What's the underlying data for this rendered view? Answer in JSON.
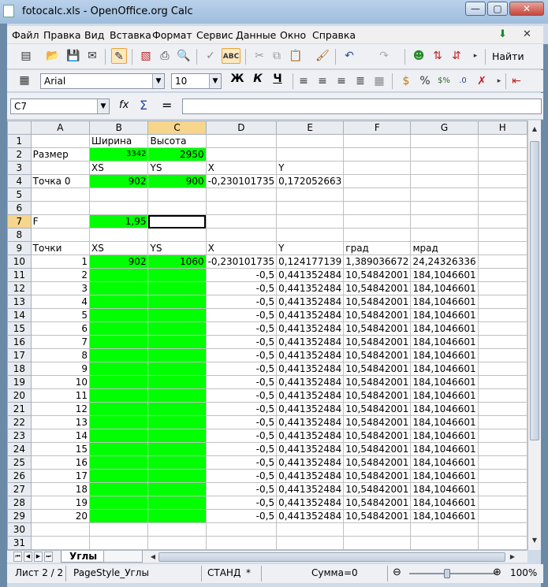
{
  "window": {
    "title": "fotocalc.xls - OpenOffice.org Calc",
    "minimize": "—",
    "maximize": "▢",
    "close": "✕"
  },
  "menu": [
    {
      "label": "Файл"
    },
    {
      "label": "Правка"
    },
    {
      "label": "Вид"
    },
    {
      "label": "Вставка"
    },
    {
      "label": "Формат"
    },
    {
      "label": "Сервис"
    },
    {
      "label": "Данные"
    },
    {
      "label": "Окно"
    },
    {
      "label": "Справка"
    }
  ],
  "toolbar": {
    "find_label": "Найти"
  },
  "format": {
    "font_name": "Arial",
    "font_size": "10",
    "bold": "Ж",
    "italic": "К",
    "underline": "Ч"
  },
  "formula": {
    "cell_ref": "C7",
    "fx": "fx",
    "sum": "Σ",
    "eq": "=",
    "value": ""
  },
  "columns": [
    "A",
    "B",
    "C",
    "D",
    "E",
    "F",
    "G",
    "H"
  ],
  "rows": [
    {
      "n": "1",
      "cells": [
        "",
        "Ширина",
        "Высота",
        "",
        "",
        "",
        "",
        ""
      ]
    },
    {
      "n": "2",
      "cells": [
        "Размер",
        "3342",
        "2950",
        "",
        "",
        "",
        "",
        ""
      ]
    },
    {
      "n": "3",
      "cells": [
        "",
        "XS",
        "YS",
        "X",
        "Y",
        "",
        "",
        ""
      ]
    },
    {
      "n": "4",
      "cells": [
        "Точка 0",
        "902",
        "900",
        "-0,230101735",
        "0,172052663",
        "",
        "",
        ""
      ]
    },
    {
      "n": "5",
      "cells": [
        "",
        "",
        "",
        "",
        "",
        "",
        "",
        ""
      ]
    },
    {
      "n": "6",
      "cells": [
        "",
        "",
        "",
        "",
        "",
        "",
        "",
        ""
      ]
    },
    {
      "n": "7",
      "cells": [
        "F",
        "1,95",
        "",
        "",
        "",
        "",
        "",
        ""
      ]
    },
    {
      "n": "8",
      "cells": [
        "",
        "",
        "",
        "",
        "",
        "",
        "",
        ""
      ]
    },
    {
      "n": "9",
      "cells": [
        "Точки",
        "XS",
        "YS",
        "X",
        "Y",
        "град",
        "мрад",
        ""
      ]
    },
    {
      "n": "10",
      "cells": [
        "1",
        "902",
        "1060",
        "-0,230101735",
        "0,124177139",
        "1,389036672",
        "24,24326336",
        ""
      ]
    },
    {
      "n": "11",
      "cells": [
        "2",
        "",
        "",
        "-0,5",
        "0,441352484",
        "10,54842001",
        "184,1046601",
        ""
      ]
    },
    {
      "n": "12",
      "cells": [
        "3",
        "",
        "",
        "-0,5",
        "0,441352484",
        "10,54842001",
        "184,1046601",
        ""
      ]
    },
    {
      "n": "13",
      "cells": [
        "4",
        "",
        "",
        "-0,5",
        "0,441352484",
        "10,54842001",
        "184,1046601",
        ""
      ]
    },
    {
      "n": "14",
      "cells": [
        "5",
        "",
        "",
        "-0,5",
        "0,441352484",
        "10,54842001",
        "184,1046601",
        ""
      ]
    },
    {
      "n": "15",
      "cells": [
        "6",
        "",
        "",
        "-0,5",
        "0,441352484",
        "10,54842001",
        "184,1046601",
        ""
      ]
    },
    {
      "n": "16",
      "cells": [
        "7",
        "",
        "",
        "-0,5",
        "0,441352484",
        "10,54842001",
        "184,1046601",
        ""
      ]
    },
    {
      "n": "17",
      "cells": [
        "8",
        "",
        "",
        "-0,5",
        "0,441352484",
        "10,54842001",
        "184,1046601",
        ""
      ]
    },
    {
      "n": "18",
      "cells": [
        "9",
        "",
        "",
        "-0,5",
        "0,441352484",
        "10,54842001",
        "184,1046601",
        ""
      ]
    },
    {
      "n": "19",
      "cells": [
        "10",
        "",
        "",
        "-0,5",
        "0,441352484",
        "10,54842001",
        "184,1046601",
        ""
      ]
    },
    {
      "n": "20",
      "cells": [
        "11",
        "",
        "",
        "-0,5",
        "0,441352484",
        "10,54842001",
        "184,1046601",
        ""
      ]
    },
    {
      "n": "21",
      "cells": [
        "12",
        "",
        "",
        "-0,5",
        "0,441352484",
        "10,54842001",
        "184,1046601",
        ""
      ]
    },
    {
      "n": "22",
      "cells": [
        "13",
        "",
        "",
        "-0,5",
        "0,441352484",
        "10,54842001",
        "184,1046601",
        ""
      ]
    },
    {
      "n": "23",
      "cells": [
        "14",
        "",
        "",
        "-0,5",
        "0,441352484",
        "10,54842001",
        "184,1046601",
        ""
      ]
    },
    {
      "n": "24",
      "cells": [
        "15",
        "",
        "",
        "-0,5",
        "0,441352484",
        "10,54842001",
        "184,1046601",
        ""
      ]
    },
    {
      "n": "25",
      "cells": [
        "16",
        "",
        "",
        "-0,5",
        "0,441352484",
        "10,54842001",
        "184,1046601",
        ""
      ]
    },
    {
      "n": "26",
      "cells": [
        "17",
        "",
        "",
        "-0,5",
        "0,441352484",
        "10,54842001",
        "184,1046601",
        ""
      ]
    },
    {
      "n": "27",
      "cells": [
        "18",
        "",
        "",
        "-0,5",
        "0,441352484",
        "10,54842001",
        "184,1046601",
        ""
      ]
    },
    {
      "n": "28",
      "cells": [
        "19",
        "",
        "",
        "-0,5",
        "0,441352484",
        "10,54842001",
        "184,1046601",
        ""
      ]
    },
    {
      "n": "29",
      "cells": [
        "20",
        "",
        "",
        "-0,5",
        "0,441352484",
        "10,54842001",
        "184,1046601",
        ""
      ]
    },
    {
      "n": "30",
      "cells": [
        "",
        "",
        "",
        "",
        "",
        "",
        "",
        ""
      ]
    },
    {
      "n": "31",
      "cells": [
        "",
        "",
        "",
        "",
        "",
        "",
        "",
        ""
      ]
    }
  ],
  "sheet_tab": "Углы",
  "status": {
    "sheet": "Лист 2 / 2",
    "page_style": "PageStyle_Углы",
    "mode": "СТАНД",
    "modified": "*",
    "sum": "Сумма=0",
    "zoom": "100%"
  },
  "colors": {
    "highlight_green": "#00ff00",
    "selected_header": "#f6d58c"
  }
}
